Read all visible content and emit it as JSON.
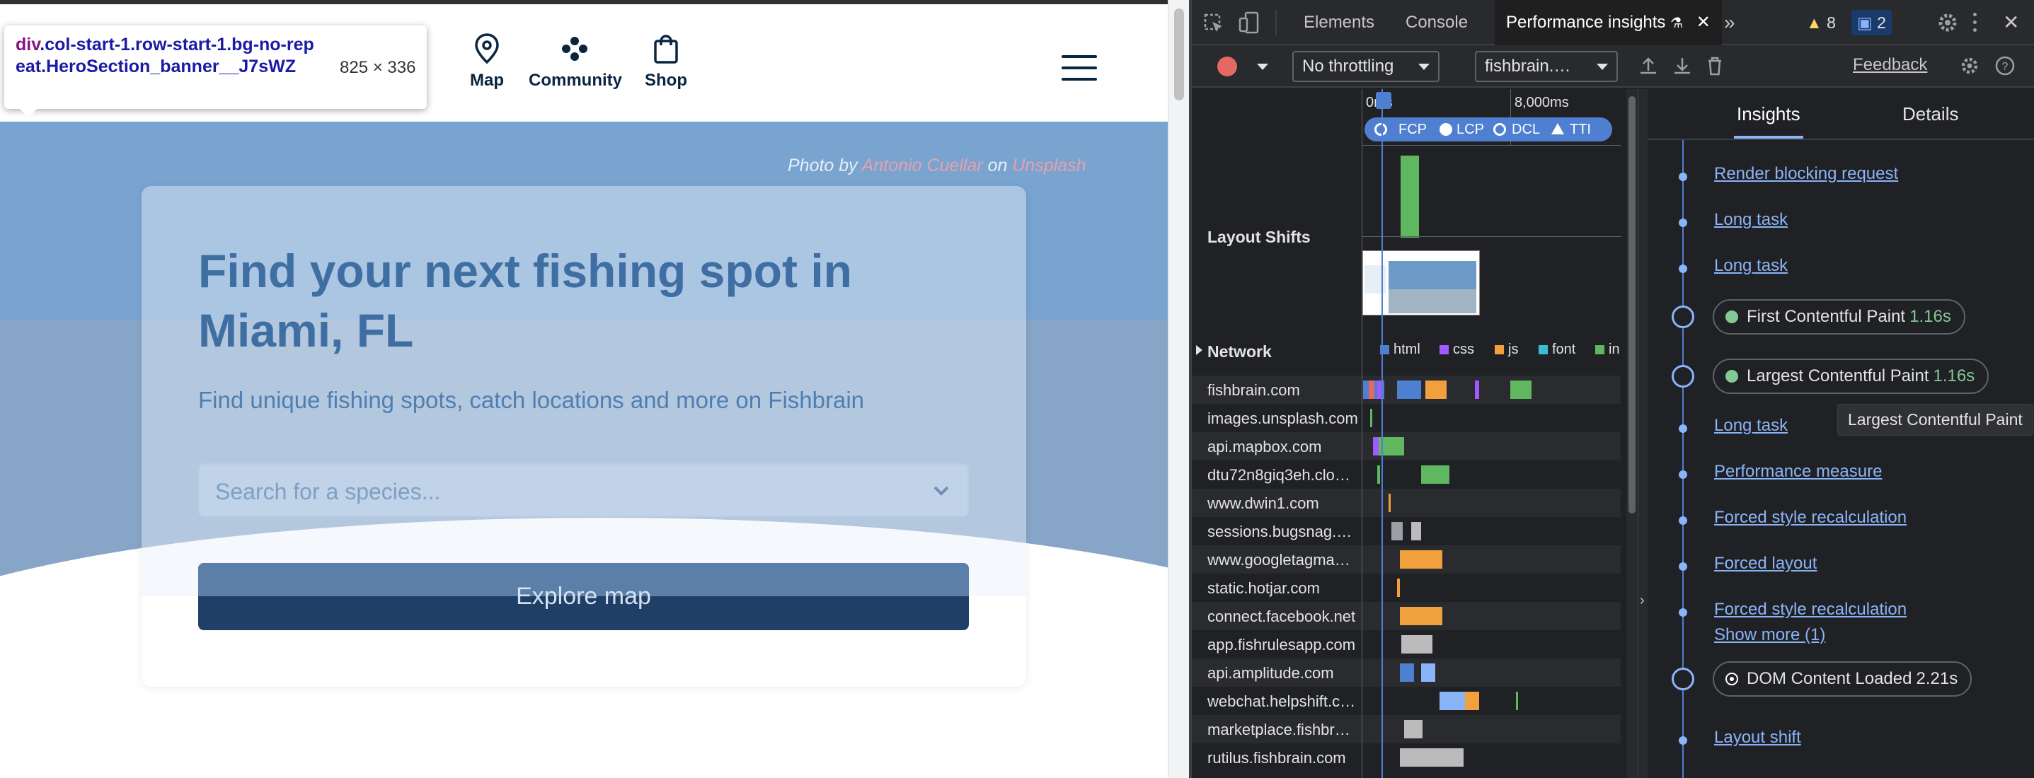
{
  "site": {
    "inspect_tooltip": {
      "selector_tag": "div",
      "selector_rest": ".col-start-1.row-start-1.bg-no-repeat.HeroSection_banner__J7sWZ",
      "dims": "825 × 336"
    },
    "nav": {
      "map": "Map",
      "community": "Community",
      "shop": "Shop"
    },
    "credit": {
      "prefix": "Photo by",
      "author": "Antonio Cuellar",
      "on": "on",
      "source": "Unsplash"
    },
    "hero": {
      "title": "Find your next fishing spot in Miami, FL",
      "subtitle": "Find unique fishing spots, catch locations and more on Fishbrain",
      "search_placeholder": "Search for a species...",
      "explore": "Explore map"
    }
  },
  "devtools": {
    "tabs": {
      "elements": "Elements",
      "console": "Console",
      "perf": "Performance insights"
    },
    "more": "»",
    "warnings": "8",
    "messages": "2",
    "toolbar": {
      "throttling": "No throttling",
      "page": "fishbrain.…",
      "feedback": "Feedback"
    },
    "timeline": {
      "tick0": "0ms",
      "tick1": "8,000ms",
      "markers": [
        "FCP",
        "LCP",
        "DCL",
        "TTI"
      ],
      "layout_shifts": "Layout Shifts",
      "network": "Network",
      "legend": [
        "html",
        "css",
        "js",
        "font",
        "in"
      ],
      "hosts": [
        "fishbrain.com",
        "images.unsplash.com",
        "api.mapbox.com",
        "dtu72n8giq3eh.clo…",
        "www.dwin1.com",
        "sessions.bugsnag.…",
        "www.googletagma…",
        "static.hotjar.com",
        "connect.facebook.net",
        "app.fishrulesapp.com",
        "api.amplitude.com",
        "webchat.helpshift.c…",
        "marketplace.fishbr…",
        "rutilus.fishbrain.com"
      ]
    },
    "insights": {
      "tabs": {
        "insights": "Insights",
        "details": "Details"
      },
      "items": {
        "render_blocking": "Render blocking request",
        "long_task_1": "Long task",
        "long_task_2": "Long task",
        "fcp_label": "First Contentful Paint",
        "fcp_value": "1.16s",
        "lcp_label": "Largest Contentful Paint",
        "lcp_value": "1.16s",
        "long_task_3": "Long task",
        "perf_measure": "Performance measure",
        "forced_style_1": "Forced style recalculation",
        "forced_layout": "Forced layout",
        "forced_style_2": "Forced style recalculation",
        "show_more": "Show more (1)",
        "dcl_label": "DOM Content Loaded",
        "dcl_value": "2.21s",
        "layout_shift": "Layout shift"
      },
      "tooltip": "Largest Contentful Paint"
    },
    "colors": {
      "html": "#4f7fd0",
      "css": "#a259ff",
      "js": "#f0a03c",
      "font": "#3dbbd6",
      "img": "#5fb760"
    }
  }
}
